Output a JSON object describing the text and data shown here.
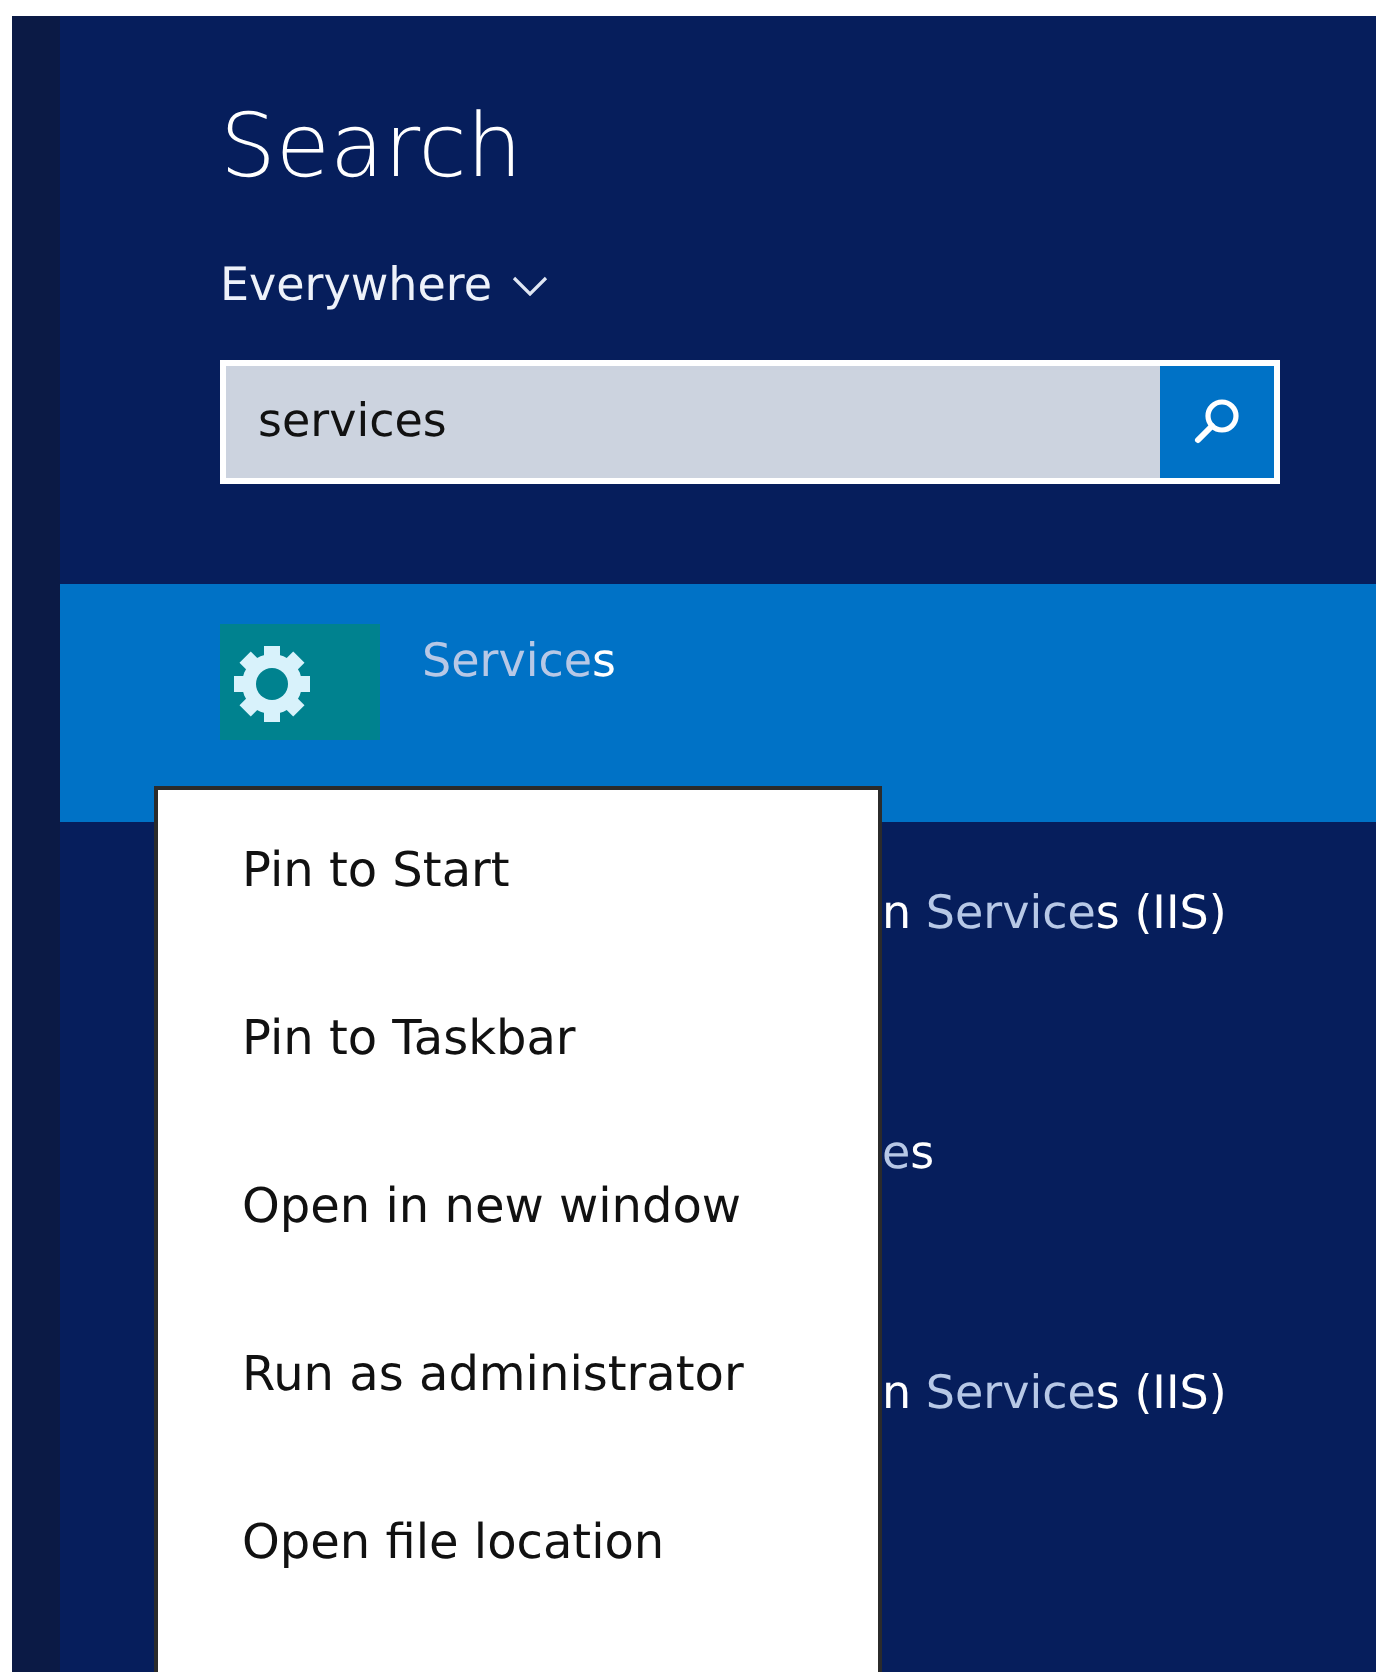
{
  "title": "Search",
  "scope": {
    "label": "Everywhere"
  },
  "search": {
    "value": "services"
  },
  "results": [
    {
      "selected": true,
      "parts": [
        {
          "text": "Service",
          "bright": false
        },
        {
          "text": "s",
          "bright": true
        }
      ]
    },
    {
      "selected": false,
      "parts": [
        {
          "text": "n ",
          "bright": true
        },
        {
          "text": "Service",
          "bright": false
        },
        {
          "text": "s (IIS)",
          "bright": true
        }
      ]
    },
    {
      "selected": false,
      "parts": [
        {
          "text": "e",
          "bright": false
        },
        {
          "text": "s",
          "bright": true
        }
      ]
    },
    {
      "selected": false,
      "parts": [
        {
          "text": "n ",
          "bright": true
        },
        {
          "text": "Service",
          "bright": false
        },
        {
          "text": "s (IIS)",
          "bright": true
        }
      ]
    }
  ],
  "context_menu": [
    "Pin to Start",
    "Pin to Taskbar",
    "Open in new window",
    "Run as administrator",
    "Open file location"
  ]
}
